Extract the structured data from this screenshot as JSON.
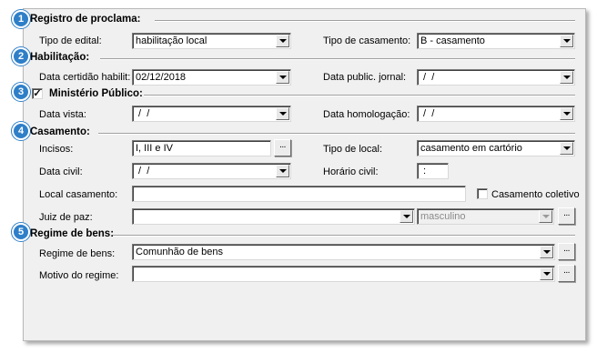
{
  "badges": [
    "1",
    "2",
    "3",
    "4",
    "5"
  ],
  "registro": {
    "title": "Registro de proclama:",
    "tipo_edital_label": "Tipo de edital:",
    "tipo_edital_value": "habilitação local",
    "tipo_casamento_label": "Tipo de casamento:",
    "tipo_casamento_value": "B - casamento"
  },
  "habilitacao": {
    "title": "Habilitação:",
    "data_certidao_label": "Data certidão habilit:",
    "data_certidao_value": "02/12/2018",
    "data_public_label": "Data public. jornal:",
    "data_public_value": " /  /"
  },
  "ministerio": {
    "title": "Ministério Público:",
    "checked": true,
    "check_mark": "✓",
    "data_vista_label": "Data vista:",
    "data_vista_value": " /  /",
    "data_homologacao_label": "Data homologação:",
    "data_homologacao_value": " /  /"
  },
  "casamento": {
    "title": "Casamento:",
    "incisos_label": "Incisos:",
    "incisos_value": "I, III e IV",
    "tipo_local_label": "Tipo de local:",
    "tipo_local_value": "casamento em cartório",
    "data_civil_label": "Data civil:",
    "data_civil_value": " /  /",
    "horario_civil_label": "Horário civil:",
    "horario_civil_value": " :",
    "local_label": "Local casamento:",
    "local_value": "",
    "coletivo_label": "Casamento coletivo",
    "coletivo_checked": false,
    "juiz_label": "Juiz de paz:",
    "juiz_value": "",
    "genero_value": "masculino"
  },
  "regime": {
    "title": "Regime de bens:",
    "regime_label": "Regime de bens:",
    "regime_value": "Comunhão de bens",
    "motivo_label": "Motivo do regime:",
    "motivo_value": ""
  },
  "ellipsis": "...",
  "colors": {
    "badge": "#2f7fc8",
    "panel": "#f0f0f0"
  }
}
